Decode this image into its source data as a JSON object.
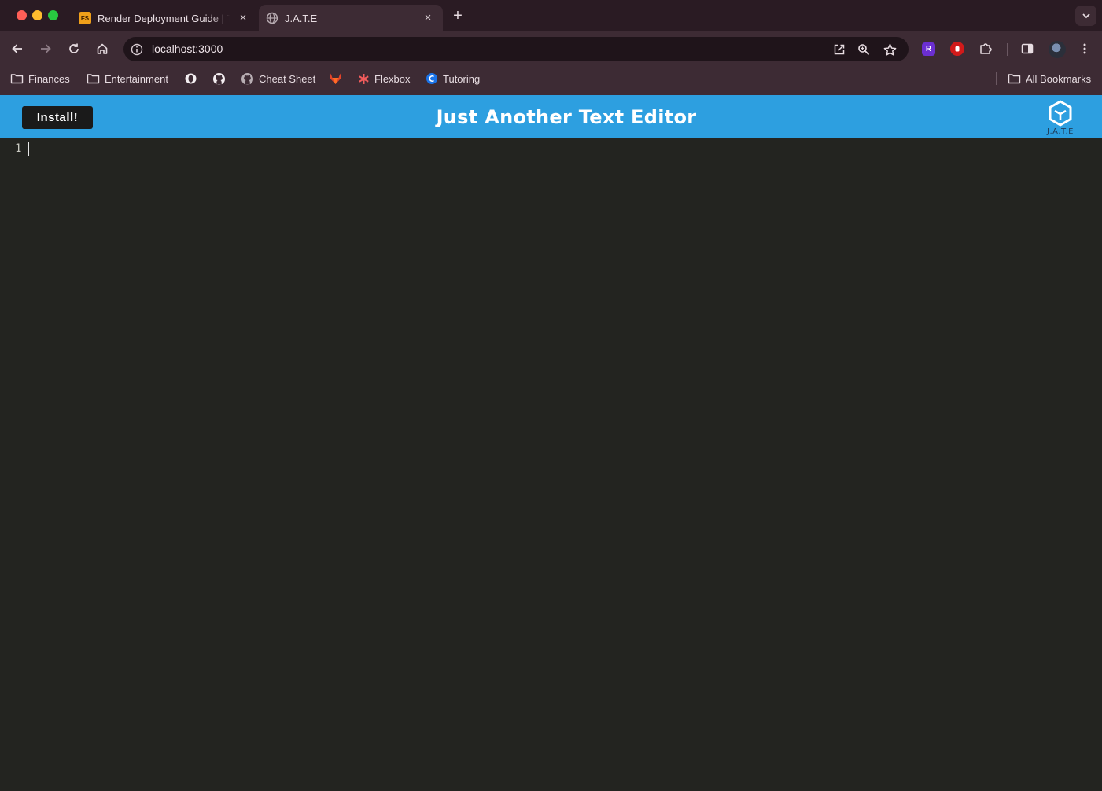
{
  "colors": {
    "tabstrip_bg": "#2a1b23",
    "toolbar_bg": "#3d2b34",
    "app_header_bg": "#2d9fe0",
    "editor_bg": "#232420",
    "install_button_bg": "#1a1a1a"
  },
  "browser": {
    "tabs": [
      {
        "title": "Render Deployment Guide | T",
        "favicon": "fs-favicon-icon",
        "close": "×"
      },
      {
        "title": "J.A.T.E",
        "favicon": "globe-icon",
        "close": "×",
        "active": true
      }
    ],
    "new_tab": "+",
    "url": "localhost:3000",
    "extension_badge": "R",
    "bookmarks": [
      {
        "label": "Finances",
        "icon": "folder-icon"
      },
      {
        "label": "Entertainment",
        "icon": "folder-icon"
      },
      {
        "label": "",
        "icon": "opera-icon"
      },
      {
        "label": "",
        "icon": "github-icon"
      },
      {
        "label": "Cheat Sheet",
        "icon": "github-icon"
      },
      {
        "label": "",
        "icon": "gitlab-icon"
      },
      {
        "label": "Flexbox",
        "icon": "asterisk-icon"
      },
      {
        "label": "Tutoring",
        "icon": "tutoring-icon"
      }
    ],
    "all_bookmarks": "All Bookmarks"
  },
  "app": {
    "install_label": "Install!",
    "title": "Just Another Text Editor",
    "logo_text": "J.A.T.E"
  },
  "editor": {
    "line_numbers": [
      "1"
    ],
    "content": ""
  }
}
